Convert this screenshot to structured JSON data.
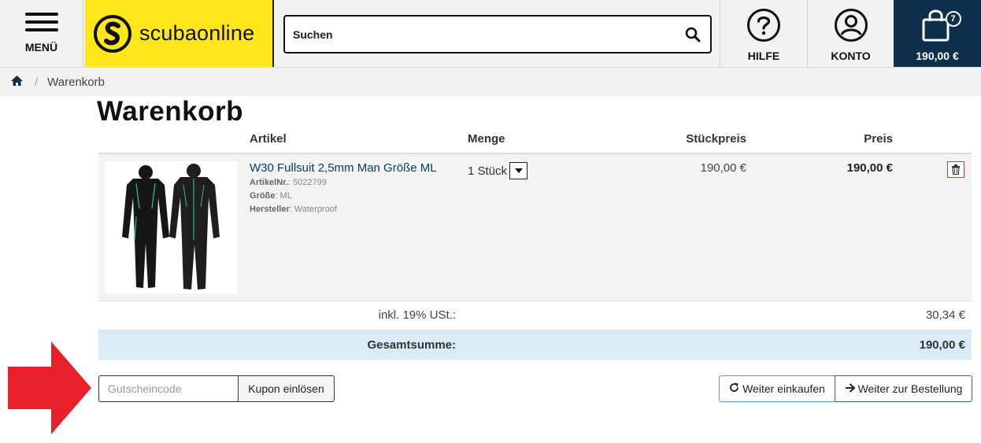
{
  "header": {
    "menu_label": "MENÜ",
    "logo_text": "scubaonline",
    "search_placeholder": "Suchen",
    "help_label": "HILFE",
    "account_label": "KONTO",
    "cart_count": "7",
    "cart_total": "190,00 €"
  },
  "breadcrumb": {
    "current": "Warenkorb"
  },
  "page_title": "Warenkorb",
  "table": {
    "headers": {
      "article": "Artikel",
      "quantity": "Menge",
      "unit_price": "Stückpreis",
      "price": "Preis"
    },
    "items": [
      {
        "name": "W30 Fullsuit 2,5mm Man Größe ML",
        "article_no_label": "ArtikelNr.",
        "article_no": "5022799",
        "size_label": "Größe",
        "size": "ML",
        "manufacturer_label": "Hersteller",
        "manufacturer": "Waterproof",
        "quantity": "1 Stück",
        "unit_price": "190,00 €",
        "price": "190,00 €"
      }
    ],
    "tax_label": "inkl. 19% USt.:",
    "tax_value": "30,34 €",
    "total_label": "Gesamtsumme:",
    "total_value": "190,00 €"
  },
  "coupon": {
    "placeholder": "Gutscheincode",
    "button_label": "Kupon einlösen"
  },
  "actions": {
    "continue_label": "Weiter einkaufen",
    "checkout_label": "Weiter zur Bestellung"
  },
  "colors": {
    "logo_bg": "#ffe71c",
    "cart_bg": "#0e2f4c",
    "total_row_bg": "#d9ecf5",
    "arrow": "#e8202a"
  }
}
